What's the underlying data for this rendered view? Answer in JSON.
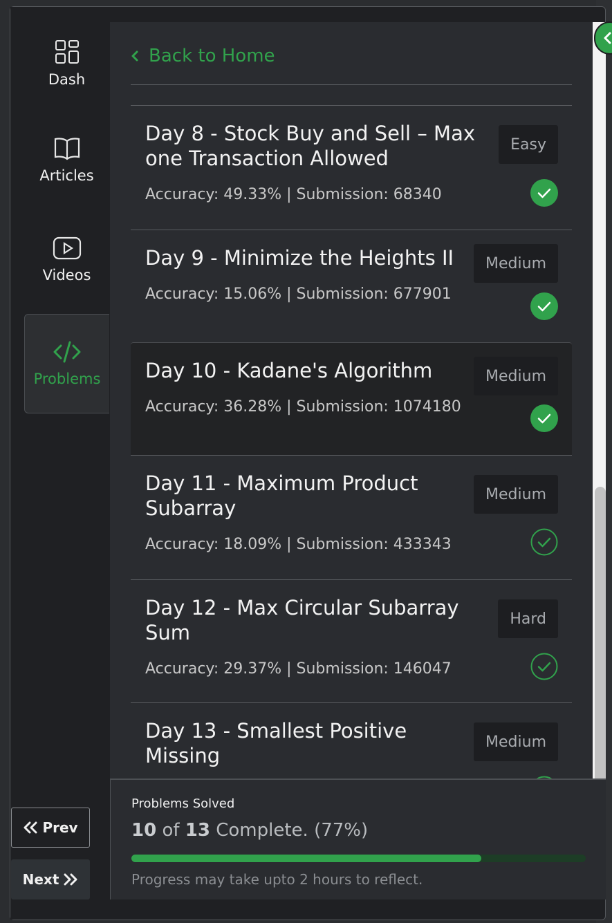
{
  "sidebar": {
    "items": [
      {
        "label": "Dash",
        "icon": "dashboard-icon"
      },
      {
        "label": "Articles",
        "icon": "book-icon"
      },
      {
        "label": "Videos",
        "icon": "play-icon"
      },
      {
        "label": "Problems",
        "icon": "code-icon",
        "active": true
      }
    ],
    "prev_label": "Prev",
    "next_label": "Next"
  },
  "main": {
    "back_label": "Back to Home",
    "problems": [
      {
        "title": "Day 8 - Stock Buy and Sell – Max one Transaction Allowed",
        "stats": "Accuracy: 49.33% | Submission: 68340",
        "difficulty": "Easy",
        "status": "solved"
      },
      {
        "title": "Day 9 - Minimize the Heights II",
        "stats": "Accuracy: 15.06% | Submission: 677901",
        "difficulty": "Medium",
        "status": "solved"
      },
      {
        "title": "Day 10 - Kadane's Algorithm",
        "stats": "Accuracy: 36.28% | Submission: 1074180",
        "difficulty": "Medium",
        "status": "solved"
      },
      {
        "title": "Day 11 - Maximum Product Subarray",
        "stats": "Accuracy: 18.09% | Submission: 433343",
        "difficulty": "Medium",
        "status": "unsolved"
      },
      {
        "title": "Day 12 - Max Circular Subarray Sum",
        "stats": "Accuracy: 29.37% | Submission: 146047",
        "difficulty": "Hard",
        "status": "unsolved"
      },
      {
        "title": "Day 13 - Smallest Positive Missing",
        "stats": "",
        "difficulty": "Medium",
        "status": "unsolved"
      }
    ]
  },
  "progress": {
    "title": "Problems Solved",
    "solved": "10",
    "of_label": "of",
    "total": "13",
    "complete_label": "Complete. (77%)",
    "fraction": 0.77,
    "note": "Progress may take upto 2 hours to reflect."
  },
  "colors": {
    "accent": "#31a24c",
    "background": "#1f2023",
    "panel": "#2a2c30"
  }
}
